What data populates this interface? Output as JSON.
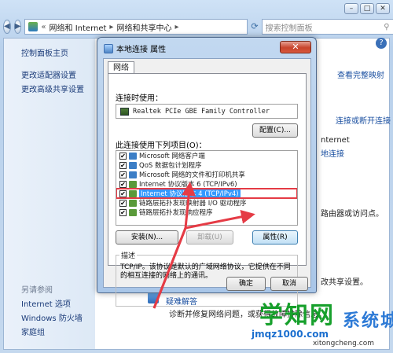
{
  "explorer": {
    "breadcrumb": [
      "网络和 Internet",
      "网络和共享中心"
    ],
    "search_placeholder": "搜索控制面板",
    "nav_chevrons": "«",
    "left_links": [
      "控制面板主页",
      "更改适配器设置",
      "更改高级共享设置"
    ],
    "see_also_title": "另请参阅",
    "see_also_links": [
      "Internet 选项",
      "Windows 防火墙",
      "家庭组"
    ],
    "right_fragments": {
      "full_map": "查看完整映射",
      "connect_disconnect": "连接或断开连接",
      "internet": "nternet",
      "local_conn": "地连接",
      "router_text": "路由器或访问点。",
      "share_text": "改共享设置。",
      "troubleshoot": "疑难解答",
      "troubleshoot_desc": "诊断并修复网络问题，或获得故障排除信息。"
    }
  },
  "dialog": {
    "title": "本地连接 属性",
    "close_label": "✕",
    "tab_label": "网络",
    "connect_using_label": "连接时使用：",
    "adapter_name": "Realtek PCIe GBE Family Controller",
    "configure_button": "配置(C)...",
    "items_label": "此连接使用下列项目(O)：",
    "items": [
      {
        "text": "Microsoft 网络客户端",
        "checked": true,
        "color": "#3c7ec6"
      },
      {
        "text": "QoS 数据包计划程序",
        "checked": true,
        "color": "#3c7ec6"
      },
      {
        "text": "Microsoft 网络的文件和打印机共享",
        "checked": true,
        "color": "#3c7ec6"
      },
      {
        "text": "Internet 协议版本 6 (TCP/IPv6)",
        "checked": true,
        "color": "#5a9a3a"
      },
      {
        "text": "Internet 协议版本 4 (TCP/IPv4)",
        "checked": true,
        "color": "#5a9a3a",
        "selected": true
      },
      {
        "text": "链路层拓扑发现映射器 I/O 驱动程序",
        "checked": true,
        "color": "#5a9a3a"
      },
      {
        "text": "链路层拓扑发现响应程序",
        "checked": true,
        "color": "#5a9a3a"
      }
    ],
    "install_button": "安装(N)...",
    "uninstall_button": "卸载(U)",
    "properties_button": "属性(R)",
    "desc_title": "描述",
    "desc_text": "TCP/IP。该协议是默认的广域网络协议，它提供在不同的相互连接的网络上的通讯。",
    "ok_button": "确定",
    "cancel_button": "取消"
  },
  "watermark": {
    "big": "学知网",
    "small": "系统城",
    "url": "jmqz1000.com",
    "url2": "xitongcheng.com"
  },
  "colors": {
    "highlight_box": "#e53b45",
    "selection": "#3399ff",
    "arrow": "#e53b45"
  }
}
